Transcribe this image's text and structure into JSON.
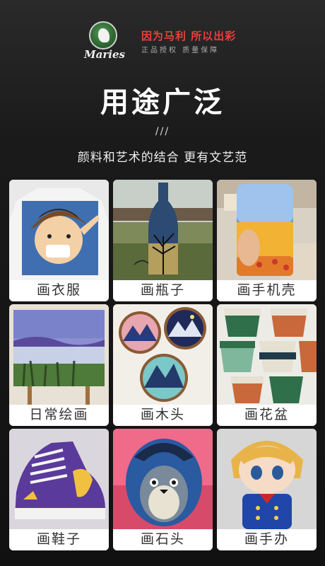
{
  "brand": {
    "logo_text": "Maries",
    "slogan": "因为马利 所以出彩",
    "subslogan": "正品授权 质量保障"
  },
  "heading": {
    "title": "用途广泛",
    "slashes": "///",
    "subtitle": "颜料和艺术的结合 更有文艺范"
  },
  "items": [
    {
      "label": "画衣服",
      "icon": "tshirt-painting-image"
    },
    {
      "label": "画瓶子",
      "icon": "bottle-painting-image"
    },
    {
      "label": "画手机壳",
      "icon": "phone-case-painting-image"
    },
    {
      "label": "日常绘画",
      "icon": "landscape-canvas-image"
    },
    {
      "label": "画木头",
      "icon": "wood-slice-painting-image"
    },
    {
      "label": "画花盆",
      "icon": "flower-pot-painting-image"
    },
    {
      "label": "画鞋子",
      "icon": "sneaker-painting-image"
    },
    {
      "label": "画石头",
      "icon": "stone-painting-image"
    },
    {
      "label": "画手办",
      "icon": "figure-painting-image"
    }
  ]
}
